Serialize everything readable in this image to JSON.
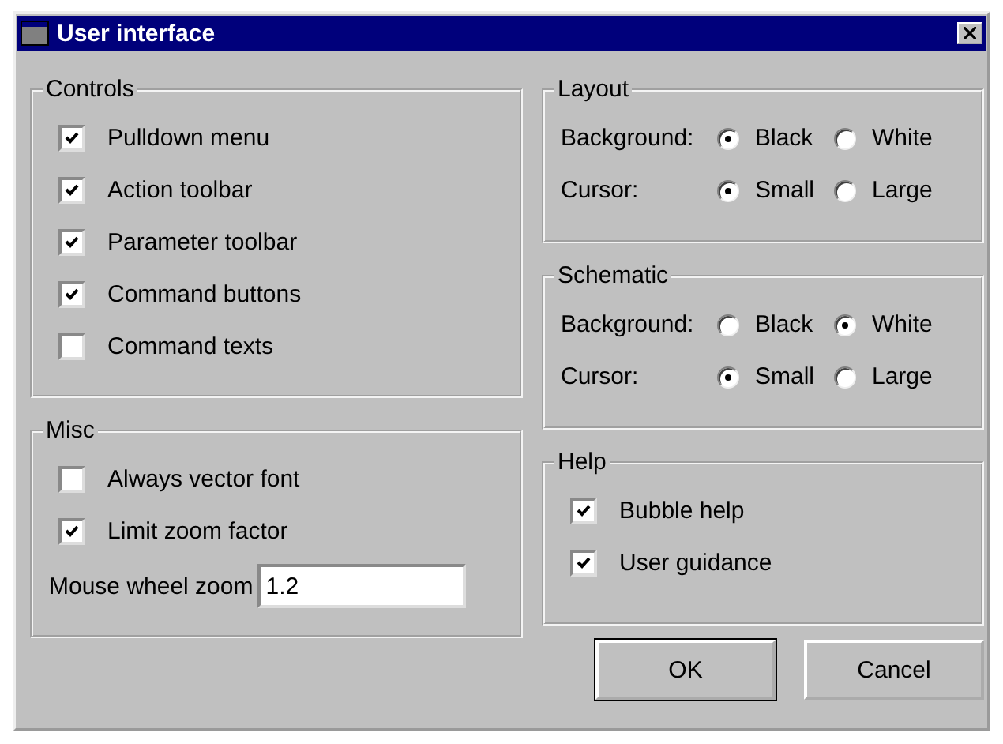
{
  "window": {
    "title": "User interface"
  },
  "controls": {
    "title": "Controls",
    "items": [
      {
        "label": "Pulldown menu",
        "checked": true
      },
      {
        "label": "Action toolbar",
        "checked": true
      },
      {
        "label": "Parameter toolbar",
        "checked": true
      },
      {
        "label": "Command buttons",
        "checked": true
      },
      {
        "label": "Command texts",
        "checked": false
      }
    ]
  },
  "misc": {
    "title": "Misc",
    "items": [
      {
        "label": "Always vector font",
        "checked": false
      },
      {
        "label": "Limit zoom factor",
        "checked": true
      }
    ],
    "zoom_field": {
      "label": "Mouse wheel zoom",
      "value": "1.2"
    }
  },
  "layout": {
    "title": "Layout",
    "rows": [
      {
        "label": "Background:",
        "options": [
          {
            "label": "Black",
            "selected": true
          },
          {
            "label": "White",
            "selected": false
          }
        ]
      },
      {
        "label": "Cursor:",
        "options": [
          {
            "label": "Small",
            "selected": true
          },
          {
            "label": "Large",
            "selected": false
          }
        ]
      }
    ]
  },
  "schematic": {
    "title": "Schematic",
    "rows": [
      {
        "label": "Background:",
        "options": [
          {
            "label": "Black",
            "selected": false
          },
          {
            "label": "White",
            "selected": true
          }
        ]
      },
      {
        "label": "Cursor:",
        "options": [
          {
            "label": "Small",
            "selected": true
          },
          {
            "label": "Large",
            "selected": false
          }
        ]
      }
    ]
  },
  "help": {
    "title": "Help",
    "items": [
      {
        "label": "Bubble help",
        "checked": true
      },
      {
        "label": "User guidance",
        "checked": true
      }
    ]
  },
  "buttons": [
    {
      "label": "OK",
      "default": true
    },
    {
      "label": "Cancel",
      "default": false
    }
  ]
}
